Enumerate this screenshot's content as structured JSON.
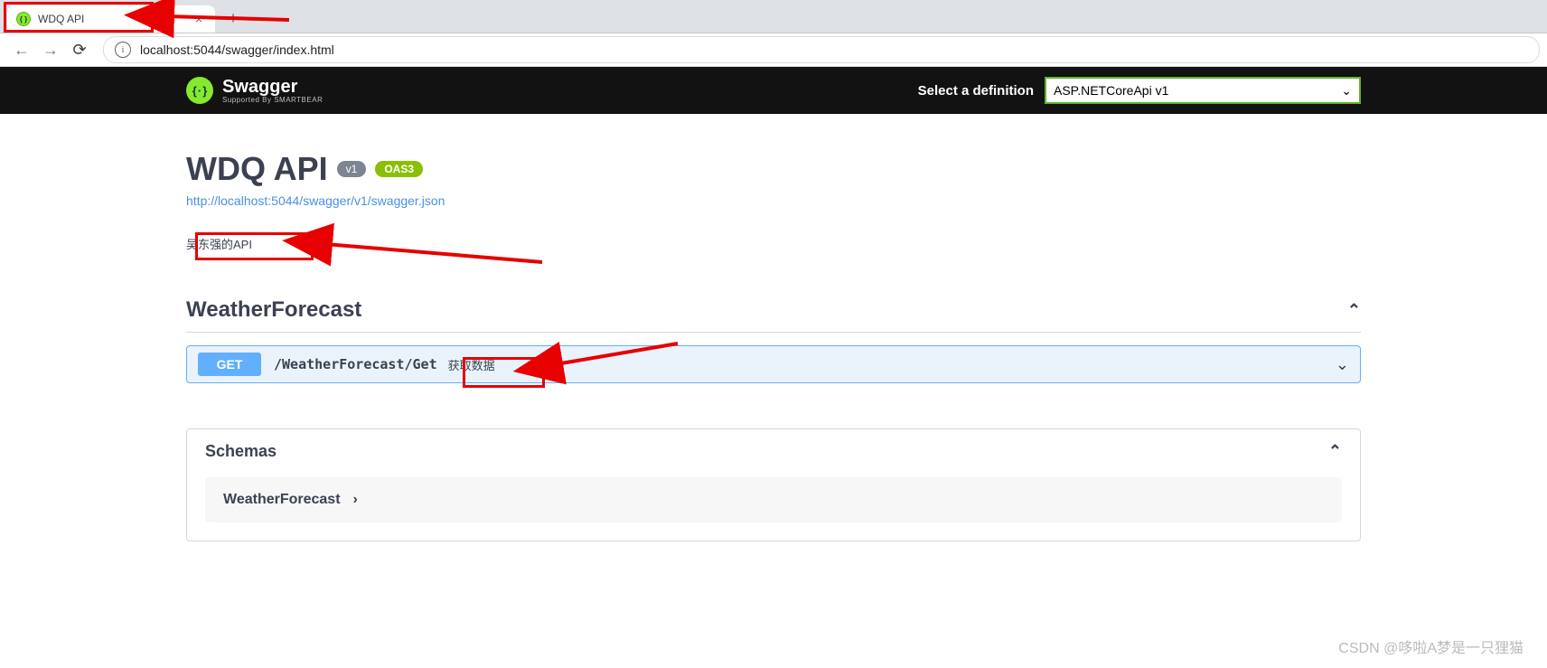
{
  "browser": {
    "tab_title": "WDQ API",
    "url_display": "localhost:5044/swagger/index.html"
  },
  "topbar": {
    "brand": "Swagger",
    "brand_sub": "Supported By SMARTBEAR",
    "select_label": "Select a definition",
    "selected_definition": "ASP.NETCoreApi v1"
  },
  "info": {
    "title": "WDQ API",
    "version_badge": "v1",
    "oas_badge": "OAS3",
    "swagger_json_url": "http://localhost:5044/swagger/v1/swagger.json",
    "description": "吴东强的API"
  },
  "tag": {
    "name": "WeatherForecast"
  },
  "operation": {
    "method": "GET",
    "path": "/WeatherForecast/Get",
    "summary": "获取数据"
  },
  "schemas": {
    "header": "Schemas",
    "items": [
      "WeatherForecast"
    ]
  },
  "watermark": "CSDN @哆啦A梦是一只狸猫"
}
